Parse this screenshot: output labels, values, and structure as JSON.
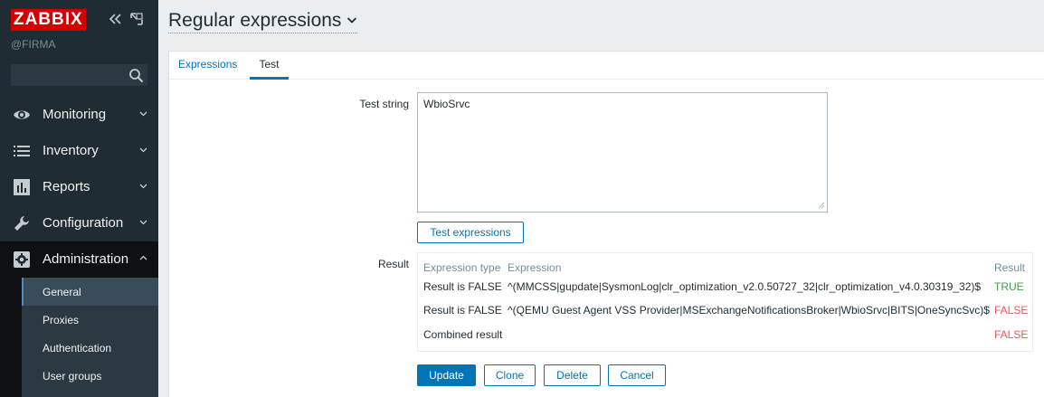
{
  "sidebar": {
    "logo": "ZABBIX",
    "server_name": "@FIRMA",
    "search_placeholder": "",
    "menu": [
      {
        "label": "Monitoring",
        "icon": "eye-icon"
      },
      {
        "label": "Inventory",
        "icon": "list-icon"
      },
      {
        "label": "Reports",
        "icon": "bar-chart-icon"
      },
      {
        "label": "Configuration",
        "icon": "wrench-icon"
      },
      {
        "label": "Administration",
        "icon": "gear-icon"
      }
    ],
    "submenu": [
      {
        "label": "General"
      },
      {
        "label": "Proxies"
      },
      {
        "label": "Authentication"
      },
      {
        "label": "User groups"
      }
    ]
  },
  "header": {
    "title": "Regular expressions"
  },
  "tabs": [
    {
      "label": "Expressions"
    },
    {
      "label": "Test"
    }
  ],
  "form": {
    "test_string_label": "Test string",
    "test_string_value": "WbioSrvc",
    "test_button": "Test expressions",
    "result_label": "Result"
  },
  "result_table": {
    "headers": {
      "type": "Expression type",
      "expression": "Expression",
      "result": "Result"
    },
    "rows": [
      {
        "type": "Result is FALSE",
        "expression": "^(MMCSS|gupdate|SysmonLog|clr_optimization_v2.0.50727_32|clr_optimization_v4.0.30319_32)$",
        "result": "TRUE"
      },
      {
        "type": "Result is FALSE",
        "expression": "^(QEMU Guest Agent VSS Provider|MSExchangeNotificationsBroker|WbioSrvc|BITS|OneSyncSvc)$",
        "result": "FALSE"
      }
    ],
    "combined_label": "Combined result",
    "combined_result": "FALSE"
  },
  "buttons": {
    "update": "Update",
    "clone": "Clone",
    "delete": "Delete",
    "cancel": "Cancel"
  },
  "colors": {
    "sidebar_bg": "#1f2c33",
    "logo_red": "#d40000",
    "accent_blue": "#0275b8",
    "true_green": "#429e47",
    "false_red": "#e45959"
  }
}
